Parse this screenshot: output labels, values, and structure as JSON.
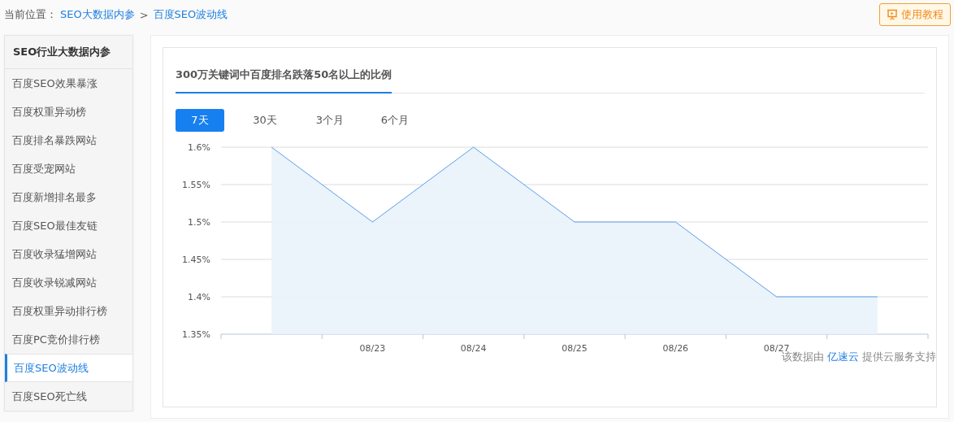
{
  "breadcrumb": {
    "label": "当前位置：",
    "links": [
      "SEO大数据内参",
      "百度SEO波动线"
    ],
    "separator": ">"
  },
  "help_button": {
    "label": "使用教程"
  },
  "sidebar": {
    "title": "SEO行业大数据内参",
    "items": [
      {
        "label": "百度SEO效果暴涨",
        "selected": false
      },
      {
        "label": "百度权重异动榜",
        "selected": false
      },
      {
        "label": "百度排名暴跌网站",
        "selected": false
      },
      {
        "label": "百度受宠网站",
        "selected": false
      },
      {
        "label": "百度新增排名最多",
        "selected": false
      },
      {
        "label": "百度SEO最佳友链",
        "selected": false
      },
      {
        "label": "百度收录猛增网站",
        "selected": false
      },
      {
        "label": "百度收录锐减网站",
        "selected": false
      },
      {
        "label": "百度权重异动排行榜",
        "selected": false
      },
      {
        "label": "百度PC竞价排行榜",
        "selected": false
      },
      {
        "label": "百度SEO波动线",
        "selected": true
      },
      {
        "label": "百度SEO死亡线",
        "selected": false
      }
    ]
  },
  "panel": {
    "tab": "300万关键词中百度排名跌落50名以上的比例",
    "ranges": [
      {
        "label": "7天",
        "selected": true
      },
      {
        "label": "30天",
        "selected": false
      },
      {
        "label": "3个月",
        "selected": false
      },
      {
        "label": "6个月",
        "selected": false
      }
    ],
    "chart_data": {
      "type": "area",
      "categories": [
        null,
        "08/23",
        "08/24",
        "08/25",
        "08/26",
        "08/27",
        null
      ],
      "series": [
        {
          "color": "#5b9ee8",
          "values": [
            1.6,
            1.5,
            1.6,
            1.5,
            1.5,
            1.4,
            1.4
          ]
        }
      ],
      "grid": true,
      "ylim": [
        1.35,
        1.6
      ],
      "yticks": [
        {
          "value": 1.35,
          "label": "1.35%"
        },
        {
          "value": 1.4,
          "label": "1.4%"
        },
        {
          "value": 1.45,
          "label": "1.45%"
        },
        {
          "value": 1.5,
          "label": "1.5%"
        },
        {
          "value": 1.55,
          "label": "1.55%"
        },
        {
          "value": 1.6,
          "label": "1.6%"
        }
      ]
    },
    "credit": {
      "before": "该数据由",
      "link": "亿速云",
      "after": "提供云服务支持"
    }
  }
}
